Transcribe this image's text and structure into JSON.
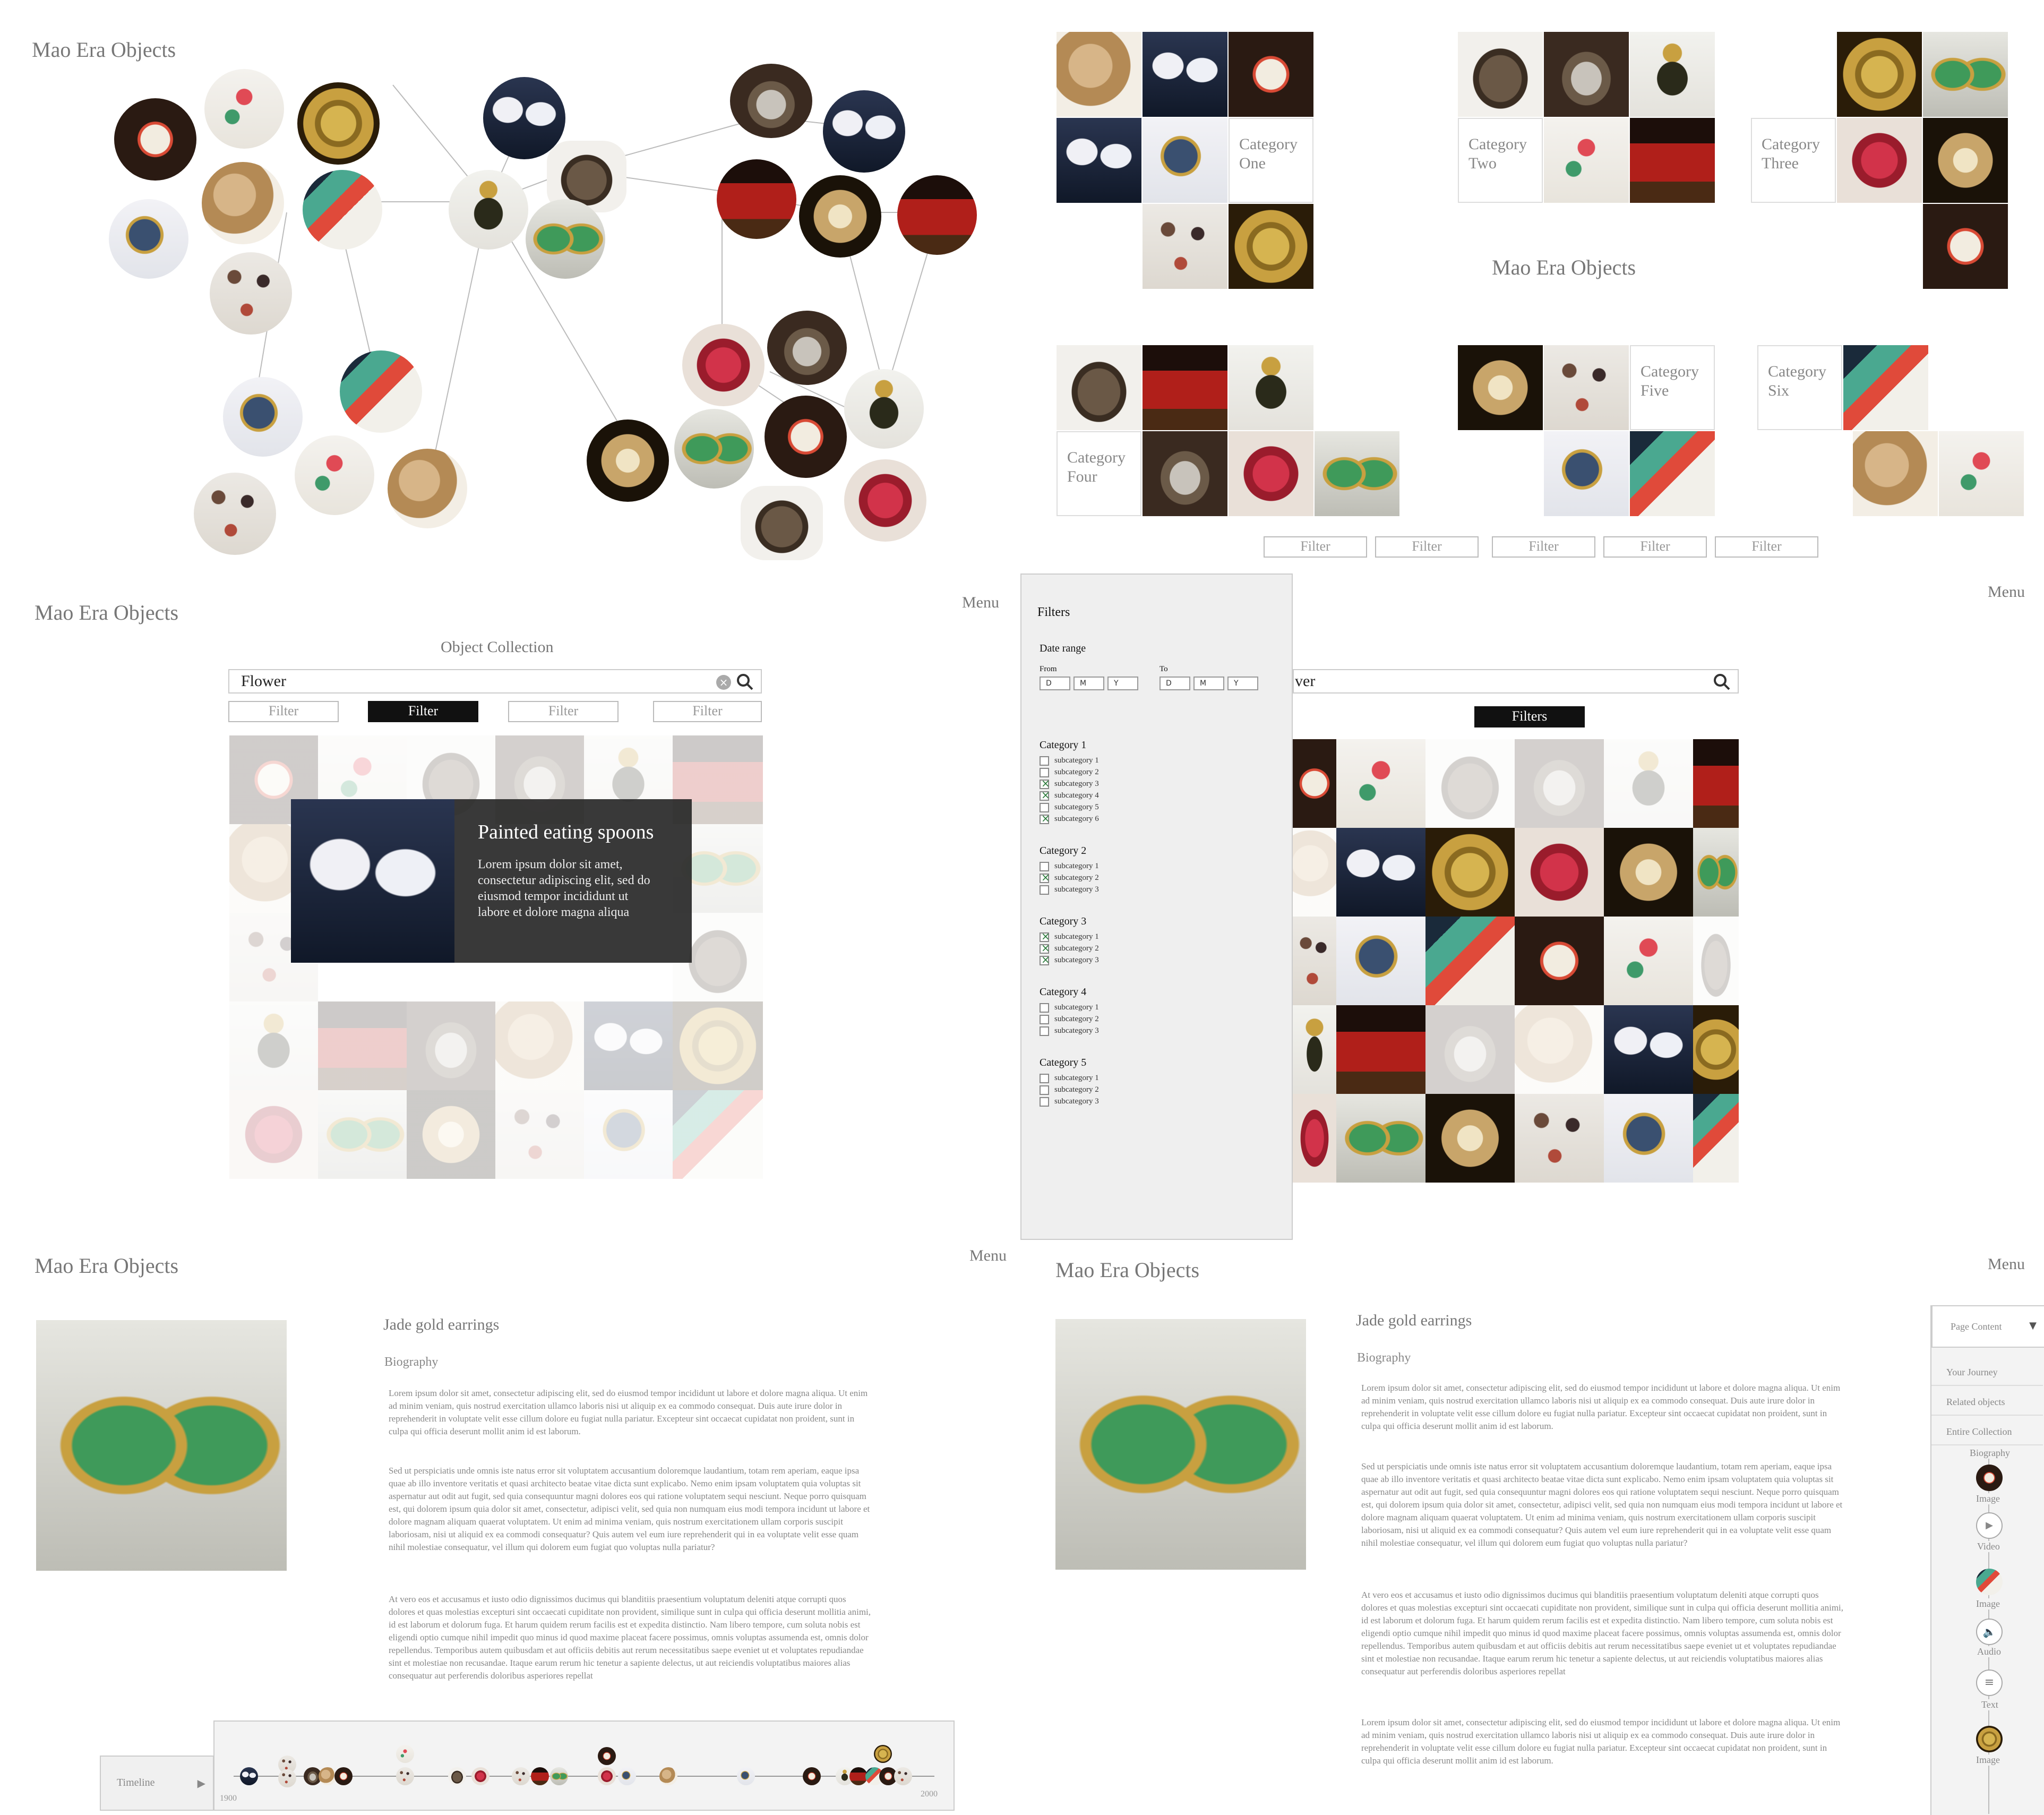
{
  "app_title": "Mao Era Objects",
  "menu_label": "Menu",
  "categories": [
    "Category One",
    "Category Two",
    "Category Three",
    "Category Four",
    "Category Five",
    "Category Six"
  ],
  "filter_label": "Filter",
  "filters_label": "Filters",
  "collection": {
    "heading": "Object Collection",
    "search_value": "Flower",
    "overlay_title": "Painted eating spoons",
    "overlay_text": "Lorem ipsum dolor sit amet, consectetur adipiscing elit, sed do eiusmod tempor incididunt ut labore et dolore magna aliqua"
  },
  "filter_panel": {
    "title": "Filters",
    "date_range": "Date range",
    "from": "From",
    "to": "To",
    "day": "D",
    "month": "M",
    "year": "Y",
    "search_suffix": "ver",
    "groups": [
      {
        "label": "Category 1",
        "subs": [
          "subcategory 1",
          "subcategory 2",
          "subcategory 3",
          "subcategory 4",
          "subcategory 5",
          "subcategory 6"
        ],
        "checked": [
          false,
          false,
          true,
          true,
          false,
          true
        ]
      },
      {
        "label": "Category 2",
        "subs": [
          "subcategory 1",
          "subcategory 2",
          "subcategory 3"
        ],
        "checked": [
          false,
          true,
          false
        ]
      },
      {
        "label": "Category 3",
        "subs": [
          "subcategory 1",
          "subcategory 2",
          "subcategory 3"
        ],
        "checked": [
          true,
          true,
          true
        ]
      },
      {
        "label": "Category 4",
        "subs": [
          "subcategory 1",
          "subcategory 2",
          "subcategory 3"
        ],
        "checked": [
          false,
          false,
          false
        ]
      },
      {
        "label": "Category 5",
        "subs": [
          "subcategory 1",
          "subcategory 2",
          "subcategory 3"
        ],
        "checked": [
          false,
          false,
          false
        ]
      }
    ]
  },
  "detail": {
    "object_title": "Jade gold earrings",
    "section": "Biography",
    "para1": "Lorem ipsum dolor sit amet, consectetur adipiscing elit, sed do eiusmod tempor incididunt ut labore et dolore magna aliqua. Ut enim ad minim veniam, quis nostrud exercitation ullamco laboris nisi ut aliquip ex ea commodo consequat. Duis aute irure dolor in reprehenderit in voluptate velit esse cillum dolore eu fugiat nulla pariatur. Excepteur sint occaecat cupidatat non proident, sunt in culpa qui officia deserunt mollit anim id est laborum.",
    "para2": "Sed ut perspiciatis unde omnis iste natus error sit voluptatem accusantium doloremque laudantium, totam rem aperiam, eaque ipsa quae ab illo inventore veritatis et quasi architecto beatae vitae dicta sunt explicabo. Nemo enim ipsam voluptatem quia voluptas sit aspernatur aut odit aut fugit, sed quia consequuntur magni dolores eos qui ratione voluptatem sequi nesciunt. Neque porro quisquam est, qui dolorem ipsum quia dolor sit amet, consectetur, adipisci velit, sed quia non numquam eius modi tempora incidunt ut labore et dolore magnam aliquam quaerat voluptatem. Ut enim ad minima veniam, quis nostrum exercitationem ullam corporis suscipit laboriosam, nisi ut aliquid ex ea commodi consequatur? Quis autem vel eum iure reprehenderit qui in ea voluptate velit esse quam nihil molestiae consequatur, vel illum qui dolorem eum fugiat quo voluptas nulla pariatur?",
    "para3": "At vero eos et accusamus et iusto odio dignissimos ducimus qui blanditiis praesentium voluptatum deleniti atque corrupti quos dolores et quas molestias excepturi sint occaecati cupiditate non provident, similique sunt in culpa qui officia deserunt mollitia animi, id est laborum et dolorum fuga. Et harum quidem rerum facilis est et expedita distinctio. Nam libero tempore, cum soluta nobis est eligendi optio cumque nihil impedit quo minus id quod maxime placeat facere possimus, omnis voluptas assumenda est, omnis dolor repellendus. Temporibus autem quibusdam et aut officiis debitis aut rerum necessitatibus saepe eveniet ut et voluptates repudiandae sint et molestiae non recusandae. Itaque earum rerum hic tenetur a sapiente delectus, ut aut reiciendis voluptatibus maiores alias consequatur aut perferendis doloribus asperiores repellat",
    "para4": "Lorem ipsum dolor sit amet, consectetur adipiscing elit, sed do eiusmod tempor incididunt ut labore et dolore magna aliqua. Ut enim ad minim veniam, quis nostrud exercitation ullamco laboris nisi ut aliquip ex ea commodo consequat. Duis aute irure dolor in reprehenderit in voluptate velit esse cillum dolore eu fugiat nulla pariatur. Excepteur sint occaecat cupidatat non proident, sunt in culpa qui officia deserunt mollit anim id est laborum.",
    "timeline_label": "Timeline",
    "timeline_start": "1900",
    "timeline_end": "2000"
  },
  "sidebar": {
    "header": "Page Content",
    "items": [
      "Your Journey",
      "Related objects",
      "Entire Collection"
    ],
    "steps": [
      "Biography",
      "Image",
      "Video",
      "Image",
      "Audio",
      "Text",
      "Image"
    ]
  }
}
